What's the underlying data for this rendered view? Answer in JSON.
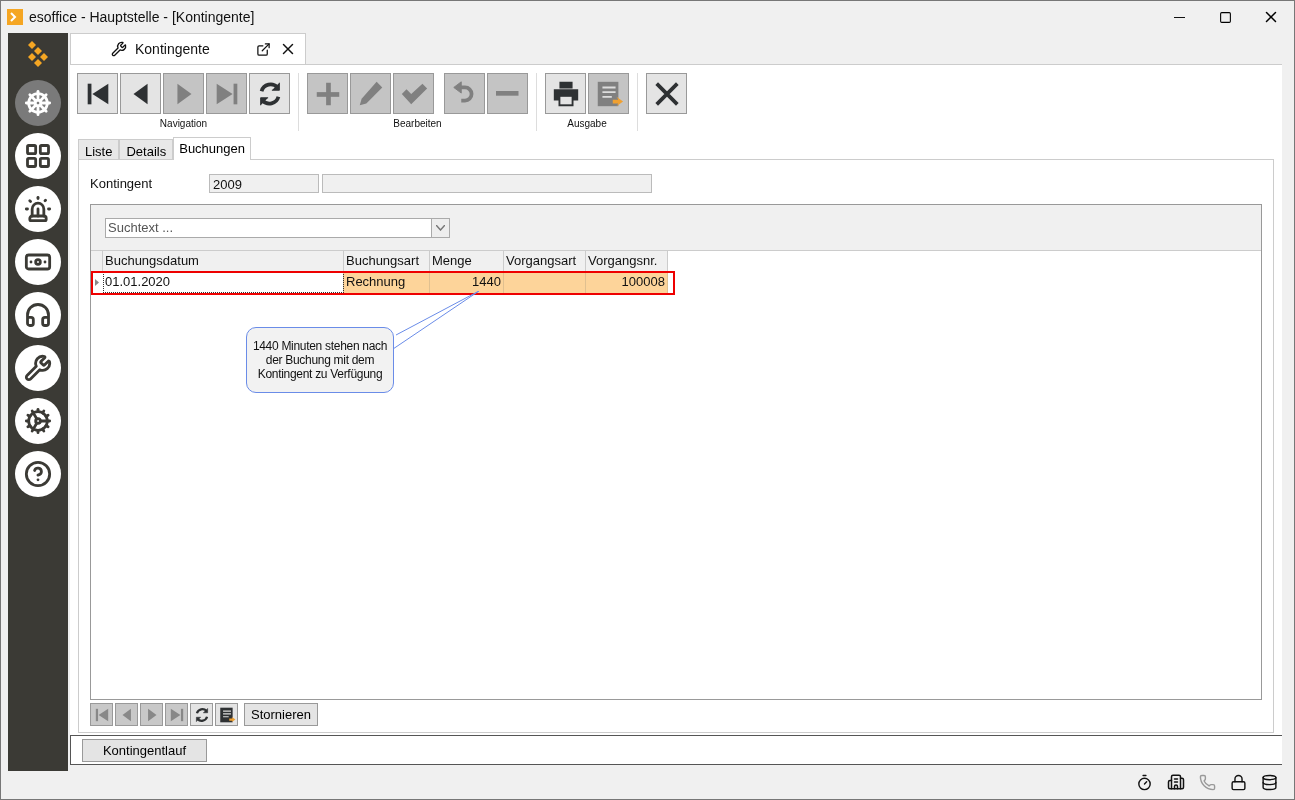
{
  "window": {
    "title": "esoffice - Hauptstelle - [Kontingente]"
  },
  "sidebar": {
    "items": [
      {
        "kind": "wheel",
        "selected": true
      },
      {
        "kind": "grid",
        "selected": false
      },
      {
        "kind": "siren",
        "selected": false
      },
      {
        "kind": "money",
        "selected": false
      },
      {
        "kind": "headset",
        "selected": false
      },
      {
        "kind": "tools",
        "selected": false
      },
      {
        "kind": "gears",
        "selected": false
      },
      {
        "kind": "help",
        "selected": false
      }
    ]
  },
  "doc_tab": {
    "label": "Kontingente"
  },
  "toolbar": {
    "groups": [
      {
        "label": "Navigation",
        "buttons": [
          {
            "kind": "first",
            "disabled": false
          },
          {
            "kind": "prev",
            "disabled": false
          },
          {
            "kind": "next",
            "disabled": true
          },
          {
            "kind": "last",
            "disabled": true
          },
          {
            "kind": "refresh",
            "disabled": false
          }
        ]
      },
      {
        "label": "Bearbeiten",
        "buttons": [
          {
            "kind": "add",
            "disabled": true
          },
          {
            "kind": "edit",
            "disabled": true
          },
          {
            "kind": "save",
            "disabled": true
          },
          {
            "kind": "undo",
            "disabled": true
          },
          {
            "kind": "remove",
            "disabled": true
          }
        ]
      },
      {
        "label": "Ausgabe",
        "buttons": [
          {
            "kind": "print",
            "disabled": false
          },
          {
            "kind": "export",
            "disabled": true
          }
        ]
      },
      {
        "buttons": [
          {
            "kind": "close",
            "disabled": false
          }
        ]
      }
    ]
  },
  "tabs": [
    {
      "label": "Liste",
      "selected": false
    },
    {
      "label": "Details",
      "selected": false
    },
    {
      "label": "Buchungen",
      "selected": true
    }
  ],
  "kontingent": {
    "label": "Kontingent",
    "value": "2009"
  },
  "search": {
    "placeholder": "Suchtext ..."
  },
  "table": {
    "columns": [
      "Buchungsdatum",
      "Buchungsart",
      "Menge",
      "Vorgangsart",
      "Vorgangsnr."
    ],
    "rows": [
      {
        "selected": true,
        "cells": [
          "01.01.2020",
          "Rechnung",
          "1440",
          "",
          "100008"
        ]
      }
    ]
  },
  "callout": {
    "text": "1440 Minuten stehen nach der Buchung mit dem Kontingent zu Verfügung"
  },
  "grid_nav": {
    "buttons": [
      {
        "kind": "first",
        "disabled": true
      },
      {
        "kind": "prev",
        "disabled": true
      },
      {
        "kind": "next",
        "disabled": true
      },
      {
        "kind": "last",
        "disabled": true
      },
      {
        "kind": "refresh",
        "disabled": false
      },
      {
        "kind": "export",
        "disabled": false
      }
    ],
    "action": "Stornieren"
  },
  "footer_button": "Kontingentlauf"
}
